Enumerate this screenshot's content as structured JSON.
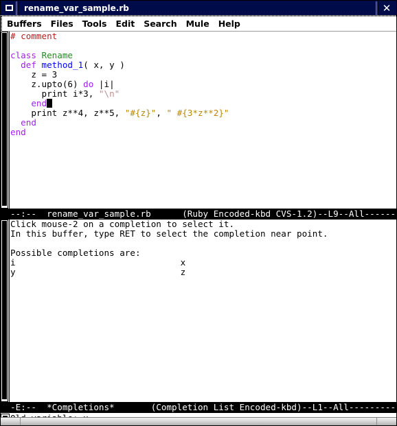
{
  "window": {
    "title": "rename_var_sample.rb",
    "sysmenu_icon": "window-box-icon",
    "close_label": "✕"
  },
  "menu_bar": {
    "items": [
      {
        "label": "Buffers"
      },
      {
        "label": "Files"
      },
      {
        "label": "Tools"
      },
      {
        "label": "Edit"
      },
      {
        "label": "Search"
      },
      {
        "label": "Mule"
      },
      {
        "label": "Help"
      }
    ]
  },
  "code_window": {
    "lines": [
      {
        "indent": "",
        "segments": [
          {
            "t": "# comment",
            "c": "tok-comment"
          }
        ]
      },
      {
        "indent": "",
        "segments": []
      },
      {
        "indent": "",
        "segments": [
          {
            "t": "class ",
            "c": "tok-keyword"
          },
          {
            "t": "Rename",
            "c": "tok-type"
          }
        ]
      },
      {
        "indent": "  ",
        "segments": [
          {
            "t": "def ",
            "c": "tok-keyword"
          },
          {
            "t": "method_1",
            "c": "tok-func"
          },
          {
            "t": "( x, y )",
            "c": ""
          }
        ]
      },
      {
        "indent": "    ",
        "segments": [
          {
            "t": "z = 3",
            "c": ""
          }
        ]
      },
      {
        "indent": "    ",
        "segments": [
          {
            "t": "z.upto(6) ",
            "c": ""
          },
          {
            "t": "do",
            "c": "tok-keyword"
          },
          {
            "t": " |i|",
            "c": ""
          }
        ]
      },
      {
        "indent": "      ",
        "segments": [
          {
            "t": "print i*3, ",
            "c": ""
          },
          {
            "t": "\"\\n\"",
            "c": "tok-string"
          }
        ]
      },
      {
        "indent": "    ",
        "segments": [
          {
            "t": "end",
            "c": "tok-keyword"
          },
          {
            "t": "█",
            "c": "cursor"
          }
        ]
      },
      {
        "indent": "    ",
        "segments": [
          {
            "t": "print z**4, z**5, ",
            "c": ""
          },
          {
            "t": "\"#{z}\"",
            "c": "tok-string2"
          },
          {
            "t": ", ",
            "c": ""
          },
          {
            "t": "\" #{3*z**2}\"",
            "c": "tok-string2"
          }
        ]
      },
      {
        "indent": "  ",
        "segments": [
          {
            "t": "end",
            "c": "tok-keyword"
          }
        ]
      },
      {
        "indent": "",
        "segments": [
          {
            "t": "end",
            "c": "tok-keyword"
          }
        ]
      }
    ],
    "mode_line": "--:--  rename_var_sample.rb      (Ruby Encoded-kbd CVS-1.2)--L9--All------------"
  },
  "completions_window": {
    "lines": [
      "Click mouse-2 on a completion to select it.",
      "In this buffer, type RET to select the completion near point.",
      "",
      "Possible completions are:",
      "i                                  x",
      "y                                  z"
    ],
    "completions": [
      {
        "left": "i",
        "right": "x"
      },
      {
        "left": "y",
        "right": "z"
      }
    ],
    "help_line_1": "Click mouse-2 on a completion to select it.",
    "help_line_2": "In this buffer, type RET to select the completion near point.",
    "heading": "Possible completions are:",
    "mode_line": "-E:--  *Completions*       (Completion List Encoded-kbd)--L1--All----------------"
  },
  "minibuffer": {
    "prompt": "Old variable: ",
    "value": "x",
    "text": "Old variable: x"
  },
  "colors": {
    "titlebar_bg": "#000b4a",
    "modeline_bg": "#000000",
    "comment": "#b22222",
    "keyword": "#a020f0",
    "type": "#228b22",
    "function": "#0000ff",
    "string": "#bc8f8f",
    "string_interp": "#b8860b"
  }
}
